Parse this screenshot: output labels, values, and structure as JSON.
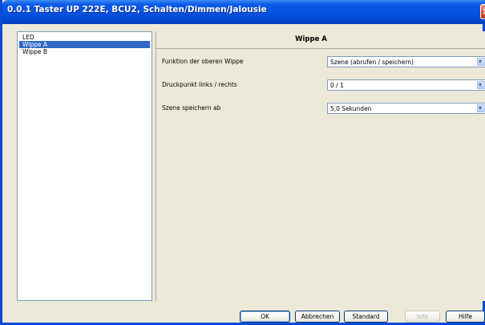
{
  "window": {
    "title": "0.0.1 Taster UP 222E, BCU2, Schalten/Dimmen/Jalousie",
    "close_glyph": "×"
  },
  "tree": {
    "items": [
      {
        "label": "LED",
        "selected": false
      },
      {
        "label": "Wippe A",
        "selected": true
      },
      {
        "label": "Wippe B",
        "selected": false
      }
    ]
  },
  "panel": {
    "title": "Wippe A",
    "params": [
      {
        "label": "Funktion der oberen Wippe",
        "value": "Szene (abrufen / speichern)"
      },
      {
        "label": "Druckpunkt links / rechts",
        "value": "0 / 1"
      },
      {
        "label": "Szene speichern ab",
        "value": "5,0 Sekunden"
      }
    ],
    "dropdown_glyph": "▾"
  },
  "buttons": {
    "ok": "OK",
    "cancel": "Abbrechen",
    "standard": "Standard",
    "info": "Info",
    "help": "Hilfe"
  },
  "colors": {
    "selection": "#316ac5",
    "titlebar": "#0552e0"
  }
}
